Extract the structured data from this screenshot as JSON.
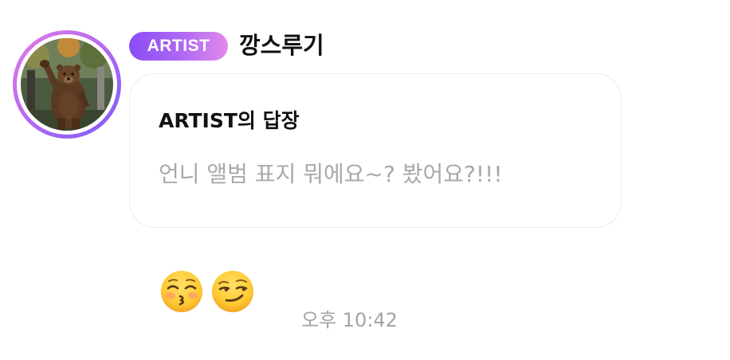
{
  "message": {
    "badge": "ARTIST",
    "nickname": "깡스루기",
    "reply": {
      "title": "ARTIST의 답장",
      "quote": "언니 앨범 표지 뭐에요~? 봤어요?!!!"
    },
    "emojis": [
      "kissing-closed-eyes",
      "smirking-face"
    ],
    "time": "오후 10:42"
  },
  "colors": {
    "badge_gradient_start": "#8a4cf6",
    "badge_gradient_end": "#e28aec",
    "avatar_ring": "#b469f2",
    "quote_text": "#a9a9ad",
    "time_text": "#a3a3a7"
  },
  "icons": {
    "avatar": "bear-photo-avatar"
  }
}
